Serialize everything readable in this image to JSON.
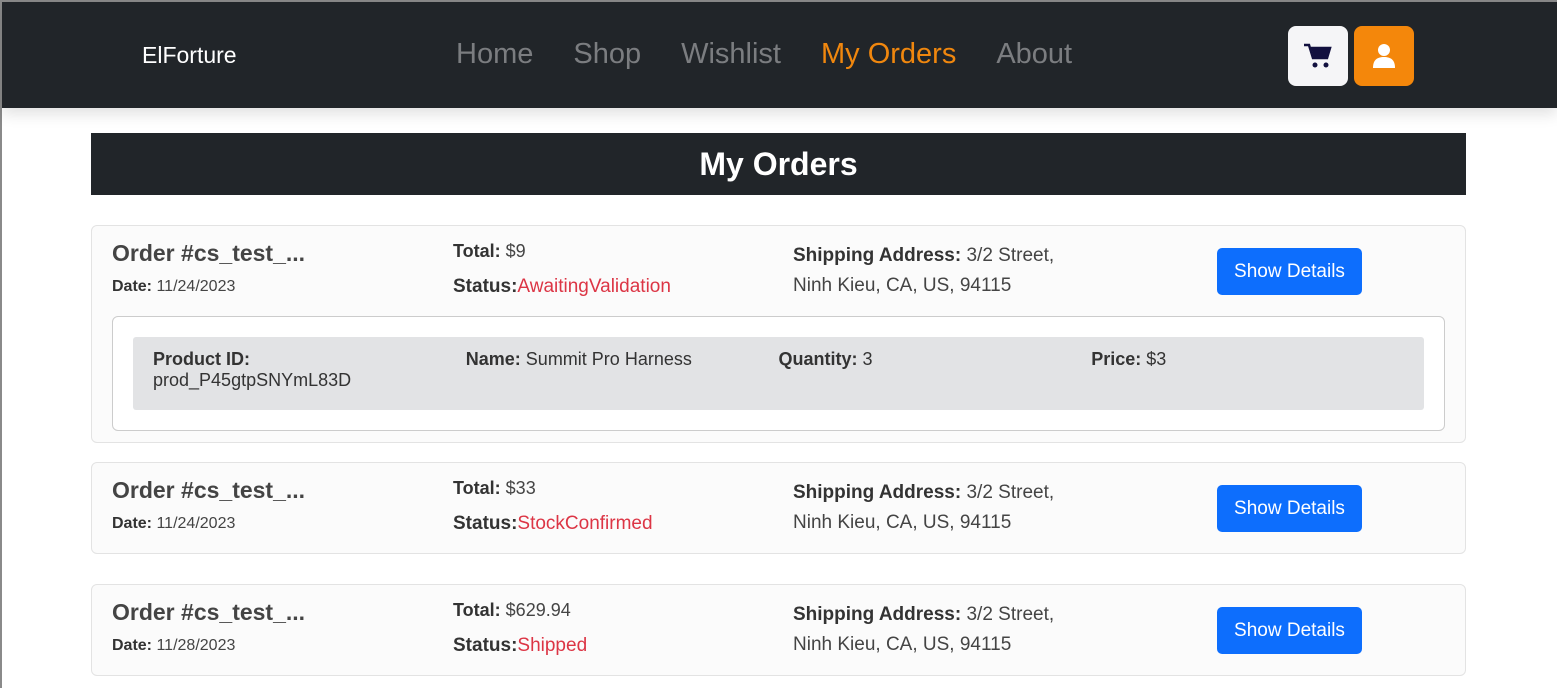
{
  "nav": {
    "brand": "ElForture",
    "links": [
      "Home",
      "Shop",
      "Wishlist",
      "My Orders",
      "About"
    ],
    "active": "My Orders",
    "cart_icon": "cart-icon",
    "user_icon": "user-icon"
  },
  "page_title": "My Orders",
  "labels": {
    "total": "Total:",
    "status": "Status:",
    "date": "Date:",
    "address": "Shipping Address:",
    "show": "Show Details",
    "product_id": "Product ID:",
    "name": "Name:",
    "quantity": "Quantity:",
    "price": "Price:"
  },
  "orders": [
    {
      "id": "Order #cs_test_...",
      "date": "11/24/2023",
      "total": "$9",
      "status": "AwaitingValidation",
      "address": "3/2 Street, Ninh Kieu, CA, US, 94115",
      "items": [
        {
          "product_id": "prod_P45gtpSNYmL83D",
          "name": "Summit Pro Harness",
          "quantity": "3",
          "price": "$3"
        }
      ]
    },
    {
      "id": "Order #cs_test_...",
      "date": "11/24/2023",
      "total": "$33",
      "status": "StockConfirmed",
      "address": "3/2 Street, Ninh Kieu, CA, US, 94115"
    },
    {
      "id": "Order #cs_test_...",
      "date": "11/28/2023",
      "total": "$629.94",
      "status": "Shipped",
      "address": "3/2 Street, Ninh Kieu, CA, US, 94115"
    }
  ],
  "colors": {
    "nav": "#212529",
    "accent": "#f0870e",
    "button": "#0d6efd",
    "status": "#dc3545"
  }
}
